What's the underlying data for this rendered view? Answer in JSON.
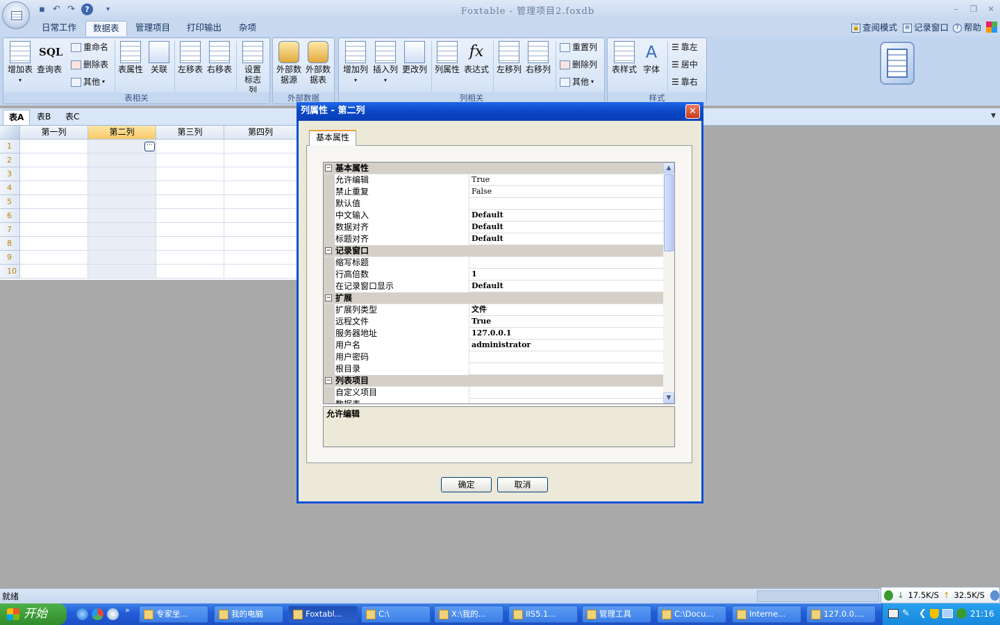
{
  "app": {
    "title": "Foxtable - 管理项目2.foxdb"
  },
  "ribbon": {
    "tabs": [
      "日常工作",
      "数据表",
      "管理项目",
      "打印输出",
      "杂项"
    ],
    "right_links": [
      "查阅模式",
      "记录窗口",
      "帮助"
    ],
    "groups": {
      "table": {
        "label": "表相关",
        "add_table": "增加表",
        "query_table": "查询表",
        "rename": "重命名",
        "delete_table": "删除表",
        "other": "其他",
        "table_props": "表属性",
        "relation": "关联",
        "move_left": "左移表",
        "move_right": "右移表",
        "set_flag_col": "设置标志列",
        "sql_text": "SQL"
      },
      "external": {
        "label": "外部数据",
        "ext_source": "外部数据源",
        "ext_table": "外部数据表"
      },
      "column": {
        "label": "列相关",
        "add_col": "增加列",
        "insert_col": "插入列",
        "change_col": "更改列",
        "col_props": "列属性",
        "expression": "表达式",
        "move_left": "左移列",
        "move_right": "右移列",
        "reset_col": "重置列",
        "delete_col": "删除列",
        "other": "其他"
      },
      "style": {
        "label": "样式",
        "table_style": "表样式",
        "font": "字体",
        "align_left": "靠左",
        "align_center": "居中",
        "align_right": "靠右"
      }
    }
  },
  "sheet_tabs": [
    "表A",
    "表B",
    "表C"
  ],
  "grid": {
    "columns": [
      "第一列",
      "第二列",
      "第三列",
      "第四列"
    ],
    "rows": [
      "1",
      "2",
      "3",
      "4",
      "5",
      "6",
      "7",
      "8",
      "9",
      "10"
    ]
  },
  "dialog": {
    "title": "列属性 - 第二列",
    "tab": "基本属性",
    "categories": [
      {
        "name": "基本属性",
        "props": [
          {
            "name": "允许编辑",
            "value": "True",
            "bold": false
          },
          {
            "name": "禁止重复",
            "value": "False",
            "bold": false
          },
          {
            "name": "默认值",
            "value": "",
            "bold": false
          },
          {
            "name": "中文输入",
            "value": "Default",
            "bold": true
          },
          {
            "name": "数据对齐",
            "value": "Default",
            "bold": true
          },
          {
            "name": "标题对齐",
            "value": "Default",
            "bold": true
          }
        ]
      },
      {
        "name": "记录窗口",
        "props": [
          {
            "name": "缩写标题",
            "value": "",
            "bold": false
          },
          {
            "name": "行高倍数",
            "value": "1",
            "bold": true
          },
          {
            "name": "在记录窗口显示",
            "value": "Default",
            "bold": true
          }
        ]
      },
      {
        "name": "扩展",
        "props": [
          {
            "name": "扩展列类型",
            "value": "文件",
            "bold": true
          },
          {
            "name": "远程文件",
            "value": "True",
            "bold": true
          },
          {
            "name": "服务器地址",
            "value": "127.0.0.1",
            "bold": true
          },
          {
            "name": "用户名",
            "value": "administrator",
            "bold": true
          },
          {
            "name": "用户密码",
            "value": "",
            "bold": false
          },
          {
            "name": "根目录",
            "value": "",
            "bold": false
          }
        ]
      },
      {
        "name": "列表项目",
        "props": [
          {
            "name": "自定义项目",
            "value": "",
            "bold": false
          },
          {
            "name": "数据表",
            "value": "",
            "bold": false
          }
        ]
      }
    ],
    "description": "允许编辑",
    "ok": "确定",
    "cancel": "取消"
  },
  "status": {
    "text": "就绪",
    "download": "17.5K/S",
    "upload": "32.5K/S"
  },
  "taskbar": {
    "start": "开始",
    "buttons": [
      "专家坐...",
      "我的电脑",
      "Foxtabl...",
      "C:\\",
      "X:\\我的...",
      "IIS5.1...",
      "管理工具",
      "C:\\Docu...",
      "Interne...",
      "127.0.0...."
    ],
    "clock": "21:16"
  }
}
